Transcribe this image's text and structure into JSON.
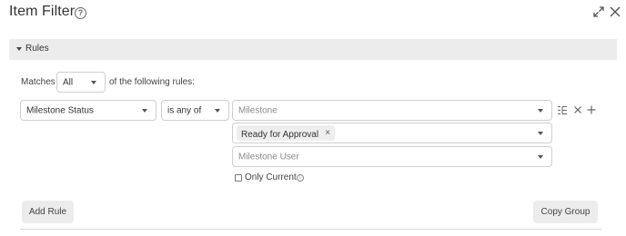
{
  "dialog": {
    "title": "Item Filter"
  },
  "icons": {
    "help": "help-circle-icon",
    "expand": "expand-icon",
    "close": "close-icon",
    "caret": "caret-down-icon",
    "list": "list-tree-icon",
    "remove": "x-icon",
    "add": "plus-icon",
    "info": "info-icon"
  },
  "rules": {
    "header_label": "Rules",
    "matches_label": "Matches",
    "matches_value": "All",
    "following_label": "of the following rules:"
  },
  "rule": {
    "field": "Milestone Status",
    "operator": "is any of",
    "source_placeholder": "Milestone",
    "selected_tag": "Ready for Approval",
    "tag_remove": "×",
    "user_placeholder": "Milestone User",
    "only_current_label": "Only Current",
    "only_current_checked": false
  },
  "buttons": {
    "add_rule": "Add Rule",
    "copy_group": "Copy Group"
  }
}
